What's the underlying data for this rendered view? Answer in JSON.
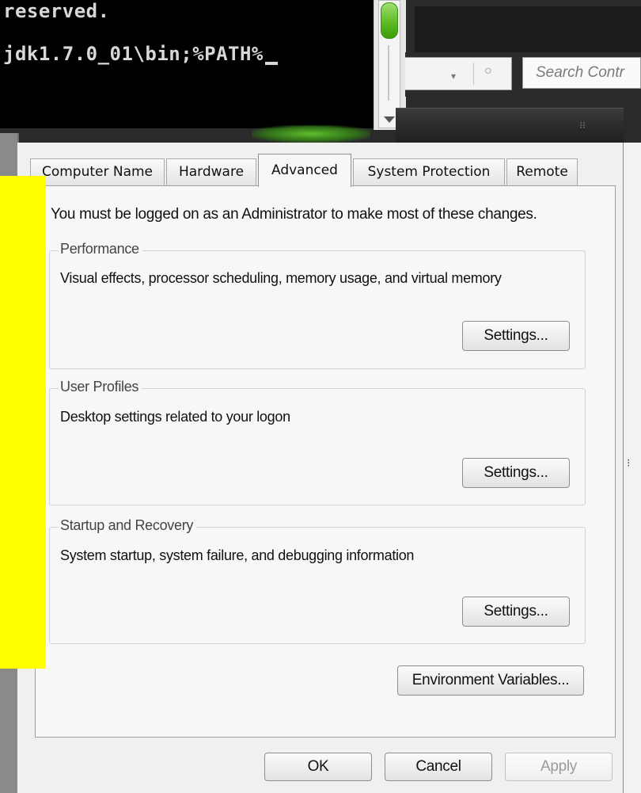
{
  "console": {
    "line1": "reserved.",
    "line2": "jdk1.7.0_01\\bin;%PATH%"
  },
  "explorer": {
    "search_placeholder": "Search Contr",
    "dropdown_glyph": "▾",
    "refresh_glyph": "○"
  },
  "dialog": {
    "tabs": [
      {
        "label": "Computer Name"
      },
      {
        "label": "Hardware"
      },
      {
        "label": "Advanced"
      },
      {
        "label": "System Protection"
      },
      {
        "label": "Remote"
      }
    ],
    "active_tab": "Advanced",
    "admin_note": "You must be logged on as an Administrator to make most of these changes.",
    "groups": [
      {
        "title": "Performance",
        "description": "Visual effects, processor scheduling, memory usage, and virtual memory",
        "button": "Settings..."
      },
      {
        "title": "User Profiles",
        "description": "Desktop settings related to your logon",
        "button": "Settings..."
      },
      {
        "title": "Startup and Recovery",
        "description": "System startup, system failure, and debugging information",
        "button": "Settings..."
      }
    ],
    "env_button": "Environment Variables...",
    "ok_button": "OK",
    "cancel_button": "Cancel",
    "apply_button": "Apply"
  },
  "colors": {
    "redaction": "#ffff00",
    "scroll_thumb": "#58b81c"
  }
}
